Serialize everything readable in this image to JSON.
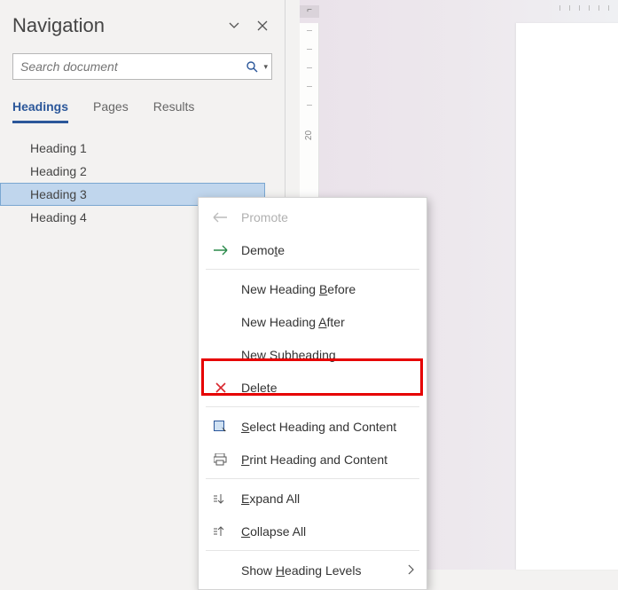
{
  "nav": {
    "title": "Navigation",
    "search_placeholder": "Search document",
    "tabs": {
      "headings": "Headings",
      "pages": "Pages",
      "results": "Results"
    },
    "items": {
      "h1": "Heading 1",
      "h2": "Heading 2",
      "h3": "Heading 3",
      "h4": "Heading 4"
    }
  },
  "ctx": {
    "promote": "Promote",
    "demote": "Demote",
    "new_before": {
      "pre": "New Heading ",
      "u": "B",
      "post": "efore"
    },
    "new_after": {
      "pre": "New Heading ",
      "u": "A",
      "post": "fter"
    },
    "new_sub": {
      "pre": "New ",
      "u": "S",
      "post": "ubheading"
    },
    "delete": "Delete",
    "select": {
      "u": "S",
      "post": "elect Heading and Content"
    },
    "print": {
      "u": "P",
      "post": "rint Heading and Content"
    },
    "expand": {
      "u": "E",
      "post": "xpand All"
    },
    "collapse": {
      "u": "C",
      "post": "ollapse All"
    },
    "levels": {
      "pre": "Show ",
      "u": "H",
      "post": "eading Levels"
    }
  },
  "ruler": {
    "num20": "20",
    "corner": "⌐"
  }
}
